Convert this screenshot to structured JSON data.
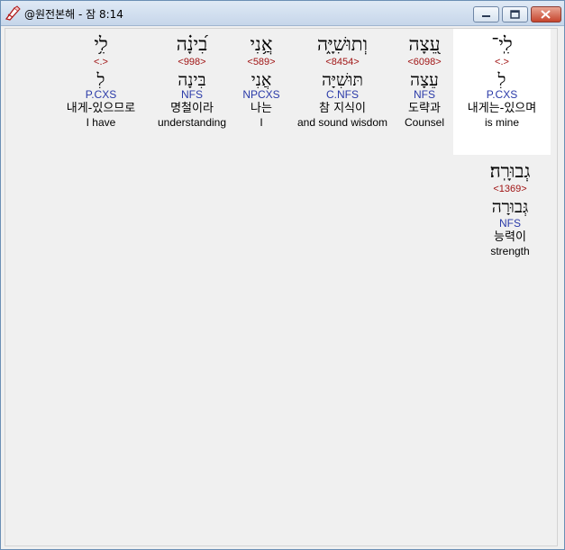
{
  "window": {
    "title": "@원전본해 - 잠 8:14"
  },
  "words": [
    {
      "hebrew": "לִ֥י",
      "strong": "<.>",
      "hebrew_plain": "לִ",
      "morph": "P.CXS",
      "korean": "내게-있으므로",
      "english": "I have"
    },
    {
      "hebrew": "בִ֝ינָ֗ה",
      "strong": "<998>",
      "hebrew_plain": "בִּינָה",
      "morph": "NFS",
      "korean": "명철이라",
      "english": "understanding"
    },
    {
      "hebrew": "אֲ֥נִי",
      "strong": "<589>",
      "hebrew_plain": "אֲנִי",
      "morph": "NPCXS",
      "korean": "나는",
      "english": "I"
    },
    {
      "hebrew": "וְתוּשִׁיָּ֑ה",
      "strong": "<8454>",
      "hebrew_plain": "תּוּשִׁיָּה",
      "morph": "C.NFS",
      "korean": "참 지식이",
      "english": "and sound wisdom"
    },
    {
      "hebrew": "עֵ֭צָה",
      "strong": "<6098>",
      "hebrew_plain": "עֵצָה",
      "morph": "NFS",
      "korean": "도략과",
      "english": "Counsel"
    },
    {
      "hebrew": "לִֽי־",
      "strong": "<.>",
      "hebrew_plain": "לִ",
      "morph": "P.CXS",
      "korean": "내게는-있으며",
      "english": "is mine"
    },
    {
      "hebrew": "גְבוּרָֽה׃",
      "strong": "<1369>",
      "hebrew_plain": "גְּבוּרָה",
      "morph": "NFS",
      "korean": "능력이",
      "english": "strength"
    }
  ]
}
